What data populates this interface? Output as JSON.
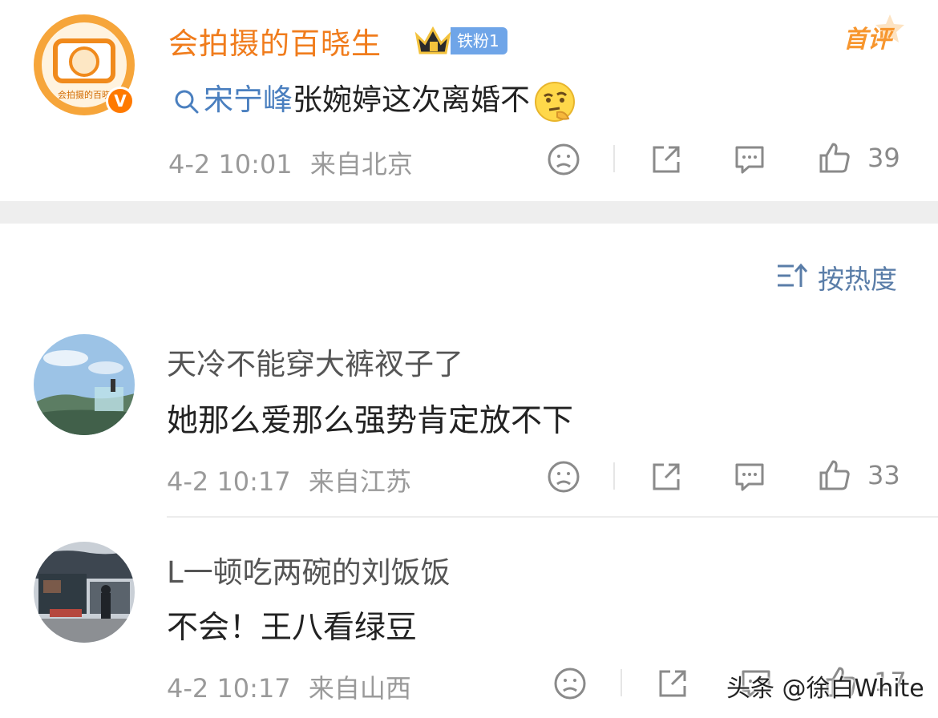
{
  "post": {
    "author": "会拍摄的百晓生",
    "avatar_caption": "会拍摄的百晓",
    "verified_mark": "V",
    "fan_badge": "铁粉1",
    "top_label": "首评",
    "topic_link": "宋宁峰",
    "text": "张婉婷这次离婚不",
    "time": "4-2 10:01",
    "location": "来自北京",
    "like_count": "39"
  },
  "sort": {
    "label": "按热度"
  },
  "comments": [
    {
      "name": "天冷不能穿大裤衩子了",
      "text": "她那么爱那么强势肯定放不下",
      "time": "4-2 10:17",
      "location": "来自江苏",
      "like_count": "33"
    },
    {
      "name": "L一顿吃两碗的刘饭饭",
      "text": "不会！王八看绿豆",
      "time": "4-2 10:17",
      "location": "来自山西",
      "like_count": "17"
    }
  ],
  "watermark": "头条 @徐白White",
  "icons": [
    "search-icon",
    "thinking-face-emoji",
    "crown-icon",
    "dislike-face-icon",
    "share-icon",
    "comment-icon",
    "thumbs-up-icon",
    "sort-icon"
  ],
  "colors": {
    "author_orange": "#f07c1c",
    "link_blue": "#4a7fbf",
    "meta_gray": "#9a9a9a",
    "badge_blue": "#6fa5e8"
  }
}
